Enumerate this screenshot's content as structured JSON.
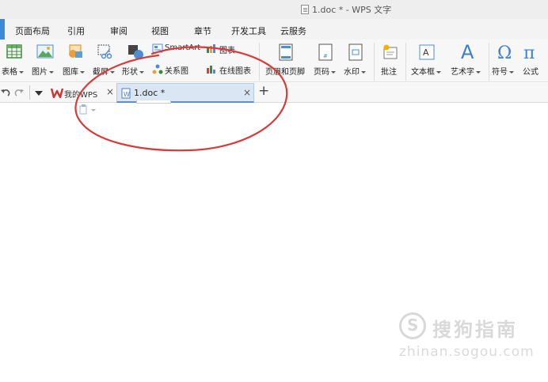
{
  "window": {
    "title": "1.doc * - WPS 文字"
  },
  "menu": {
    "tabs": [
      "页面布局",
      "引用",
      "审阅",
      "视图",
      "章节",
      "开发工具",
      "云服务"
    ]
  },
  "ribbon": {
    "table": "表格",
    "picture": "图片",
    "gallery": "图库",
    "screenshot": "截屏",
    "shapes": "形状",
    "smartart": "SmartArt",
    "chart": "图表",
    "relation": "关系图",
    "online_chart": "在线图表",
    "header_footer": "页眉和页脚",
    "page_number": "页码",
    "watermark": "水印",
    "comment": "批注",
    "textbox": "文本框",
    "wordart": "艺术字",
    "symbol": "符号",
    "formula": "公式"
  },
  "tabstrip": {
    "home_tab": "我的WPS",
    "doc_tab": "1.doc *",
    "new_tab": "+"
  },
  "watermark": {
    "brand": "搜狗指南",
    "url": "zhinan.sogou.com"
  },
  "colors": {
    "annotation_red": "#d93b3b",
    "wps_red": "#d0342c",
    "accent_blue": "#3b8ad8"
  }
}
